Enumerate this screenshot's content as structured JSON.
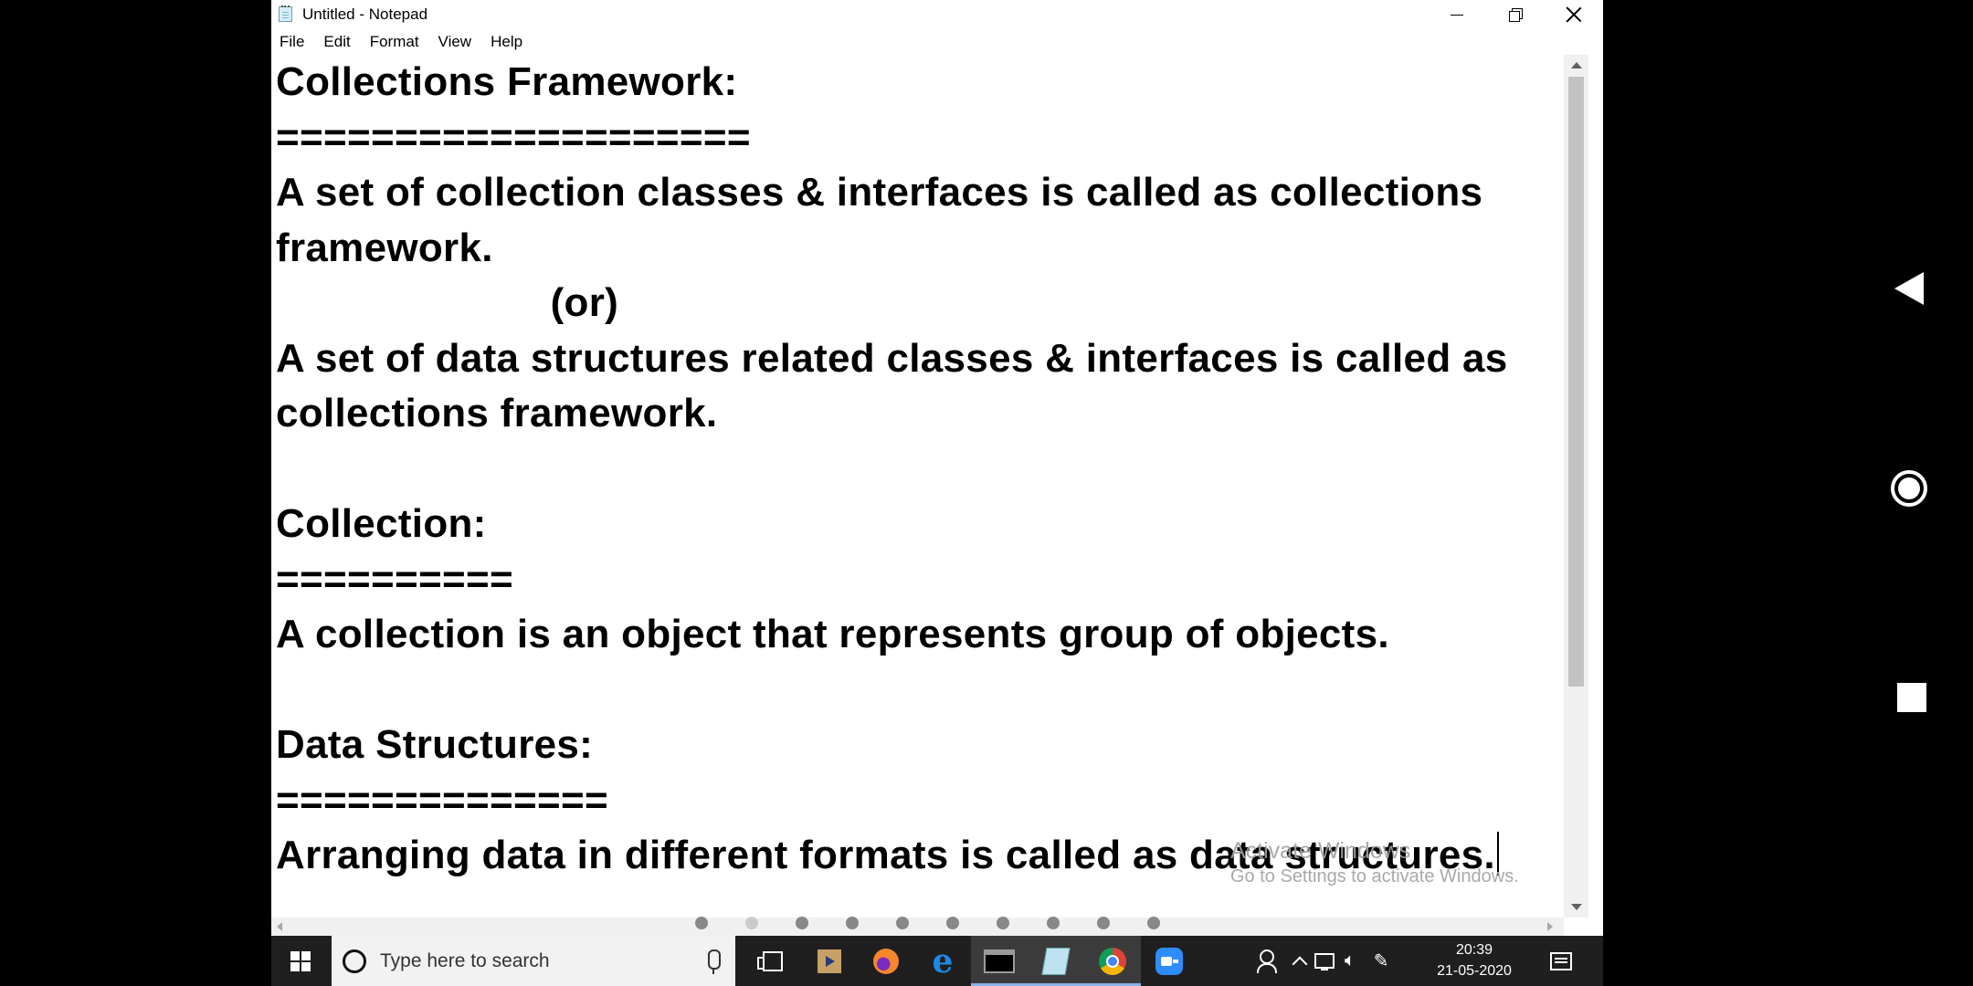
{
  "window": {
    "title": "Untitled - Notepad"
  },
  "menu": [
    "File",
    "Edit",
    "Format",
    "View",
    "Help"
  ],
  "document": {
    "lines": [
      "Collections Framework:",
      "====================",
      "A set of collection classes & interfaces is called as collections",
      "framework.",
      "                        (or)",
      "A set of data structures related classes & interfaces is called as",
      "collections framework.",
      "",
      "Collection:",
      "==========",
      "A collection is an object that represents group of objects.",
      "",
      "Data Structures:",
      "==============",
      "Arranging data in different formats is called as data structures."
    ]
  },
  "watermark": {
    "title": "Activate Windows",
    "subtitle": "Go to Settings to activate Windows."
  },
  "taskbar": {
    "search_placeholder": "Type here to search",
    "apps": [
      "task-view",
      "media-player",
      "firefox",
      "edge",
      "command-prompt",
      "notepad",
      "chrome",
      "zoom"
    ],
    "active_apps": [
      "command-prompt",
      "notepad",
      "chrome"
    ],
    "clock_time": "20:39",
    "clock_date": "21-05-2020"
  },
  "page_indicator": {
    "count": 10,
    "colors": {
      "dot": "#888888"
    }
  },
  "android_nav": [
    "back-icon",
    "home-icon",
    "recents-icon"
  ],
  "colors": {
    "window_bg": "#ffffff",
    "taskbar_bg": "#1f1f1f",
    "search_bg": "#f2f2f2",
    "scrollbar_thumb": "#c2c2c2"
  }
}
